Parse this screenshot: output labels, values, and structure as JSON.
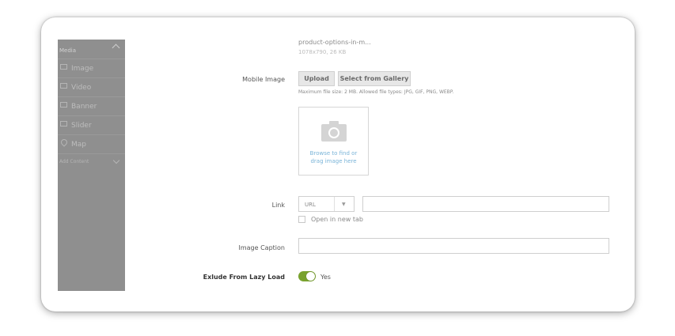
{
  "sidebar": {
    "header": "Media",
    "items": [
      {
        "label": "Image",
        "icon": "image-icon"
      },
      {
        "label": "Video",
        "icon": "video-icon"
      },
      {
        "label": "Banner",
        "icon": "banner-icon"
      },
      {
        "label": "Slider",
        "icon": "slider-icon"
      },
      {
        "label": "Map",
        "icon": "map-pin-icon"
      }
    ],
    "footer": "Add Content"
  },
  "file": {
    "name": "product-options-in-m...",
    "meta": "1078x790, 26 KB"
  },
  "mobile_image": {
    "label": "Mobile Image",
    "upload_label": "Upload",
    "gallery_label": "Select from Gallery",
    "hint": "Maximum file size: 2 MB. Allowed file types: JPG, GIF, PNG, WEBP.",
    "drop_line1": "Browse to find or",
    "drop_line2": "drag image here"
  },
  "link": {
    "label": "Link",
    "type_value": "URL",
    "url_value": "",
    "new_tab_label": "Open in new tab"
  },
  "caption": {
    "label": "Image Caption",
    "value": ""
  },
  "lazy_load": {
    "label": "Exlude From Lazy Load",
    "state_label": "Yes"
  },
  "colors": {
    "toggle_on": "#79a22e",
    "sidebar_bg": "#8f8f8f",
    "link_text": "#7ab4d8"
  }
}
